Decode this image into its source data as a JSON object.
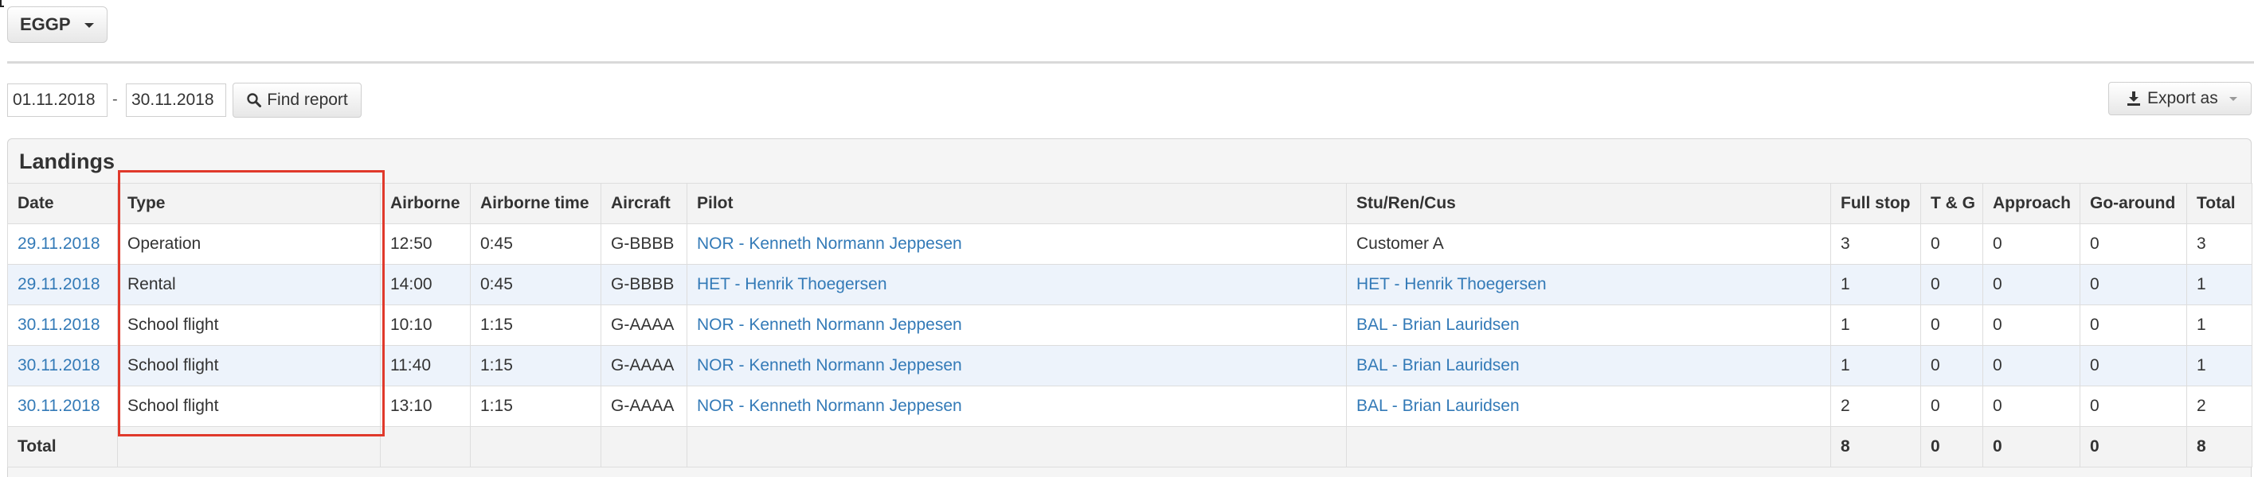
{
  "airport_selector": {
    "label": "EGGP"
  },
  "filter": {
    "date_from": "01.11.2018",
    "separator": "-",
    "date_to": "30.11.2018",
    "find_label": "Find report"
  },
  "export": {
    "label": "Export as"
  },
  "panel": {
    "title": "Landings"
  },
  "table": {
    "headers": [
      "Date",
      "Type",
      "Airborne",
      "Airborne time",
      "Aircraft",
      "Pilot",
      "Stu/Ren/Cus",
      "Full stop",
      "T & G",
      "Approach",
      "Go-around",
      "Total"
    ],
    "rows": [
      {
        "date": "29.11.2018",
        "type": "Operation",
        "airborne": "12:50",
        "airborne_time": "0:45",
        "aircraft": "G-BBBB",
        "pilot": "NOR - Kenneth Normann Jeppesen",
        "stu_ren_cus": "Customer A",
        "full_stop": "3",
        "t_g": "0",
        "approach": "0",
        "go_around": "0",
        "total": "3"
      },
      {
        "date": "29.11.2018",
        "type": "Rental",
        "airborne": "14:00",
        "airborne_time": "0:45",
        "aircraft": "G-BBBB",
        "pilot": "HET - Henrik Thoegersen",
        "stu_ren_cus": "HET - Henrik Thoegersen",
        "full_stop": "1",
        "t_g": "0",
        "approach": "0",
        "go_around": "0",
        "total": "1"
      },
      {
        "date": "30.11.2018",
        "type": "School flight",
        "airborne": "10:10",
        "airborne_time": "1:15",
        "aircraft": "G-AAAA",
        "pilot": "NOR - Kenneth Normann Jeppesen",
        "stu_ren_cus": "BAL - Brian Lauridsen",
        "full_stop": "1",
        "t_g": "0",
        "approach": "0",
        "go_around": "0",
        "total": "1"
      },
      {
        "date": "30.11.2018",
        "type": "School flight",
        "airborne": "11:40",
        "airborne_time": "1:15",
        "aircraft": "G-AAAA",
        "pilot": "NOR - Kenneth Normann Jeppesen",
        "stu_ren_cus": "BAL - Brian Lauridsen",
        "full_stop": "1",
        "t_g": "0",
        "approach": "0",
        "go_around": "0",
        "total": "1"
      },
      {
        "date": "30.11.2018",
        "type": "School flight",
        "airborne": "13:10",
        "airborne_time": "1:15",
        "aircraft": "G-AAAA",
        "pilot": "NOR - Kenneth Normann Jeppesen",
        "stu_ren_cus": "BAL - Brian Lauridsen",
        "full_stop": "2",
        "t_g": "0",
        "approach": "0",
        "go_around": "0",
        "total": "2"
      }
    ],
    "totals": {
      "label": "Total",
      "full_stop": "8",
      "t_g": "0",
      "approach": "0",
      "go_around": "0",
      "total": "8"
    }
  },
  "colors": {
    "link": "#337ab7",
    "highlight": "#e0392b",
    "stripe": "#edf3fb"
  },
  "icons": {
    "search": "search-icon",
    "export": "download-icon",
    "dropdown": "caret-down-icon"
  }
}
